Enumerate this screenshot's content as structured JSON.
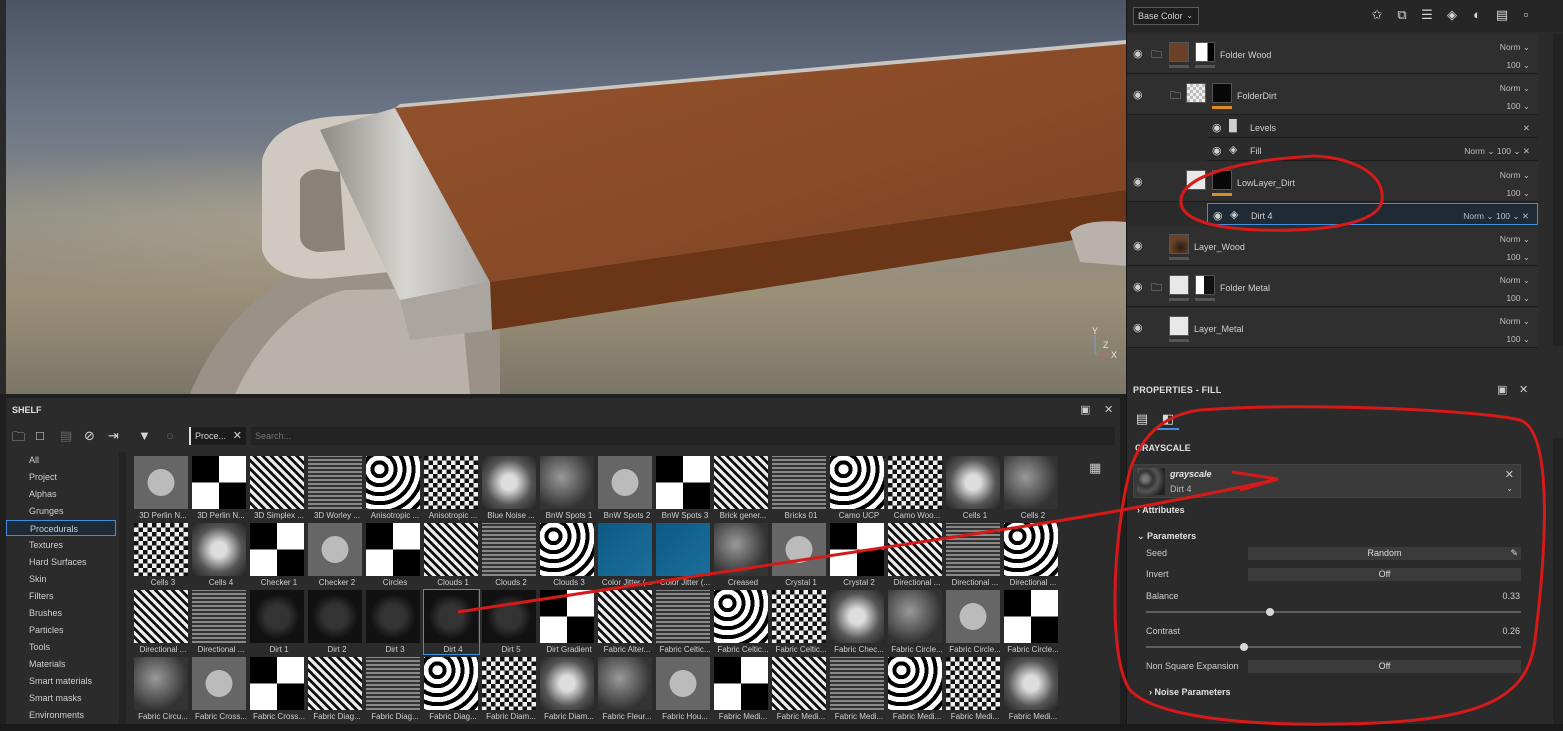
{
  "layer_stack": {
    "channel": "Base Color",
    "toolbar_icons": [
      "magic-wand-icon",
      "effect-icon",
      "add-layer-icon",
      "fill-layer-icon",
      "mask-icon",
      "folder-add-icon",
      "trash-icon"
    ],
    "layers": [
      {
        "name": "Folder Wood",
        "blend": "Norm",
        "opacity": "100"
      },
      {
        "name": "FolderDirt",
        "blend": "Norm",
        "opacity": "100"
      },
      {
        "name": "LowLayer_Dirt",
        "blend": "Norm",
        "opacity": "100"
      },
      {
        "name": "Layer_Wood",
        "blend": "Norm",
        "opacity": "100"
      },
      {
        "name": "Folder Metal",
        "blend": "Norm",
        "opacity": "100"
      },
      {
        "name": "Layer_Metal",
        "blend": "Norm",
        "opacity": "100"
      }
    ],
    "effects": [
      {
        "name": "Levels"
      },
      {
        "name": "Fill",
        "blend": "Norm",
        "opacity": "100"
      },
      {
        "name": "Dirt 4",
        "blend": "Norm",
        "opacity": "100"
      }
    ]
  },
  "properties": {
    "title": "PROPERTIES - FILL",
    "section": "GRAYSCALE",
    "resource": {
      "name": "grayscale",
      "sub": "Dirt 4"
    },
    "attributes_label": "Attributes",
    "parameters_label": "Parameters",
    "seed": {
      "label": "Seed",
      "value": "Random"
    },
    "invert": {
      "label": "Invert",
      "value": "Off"
    },
    "balance": {
      "label": "Balance",
      "value": "0.33",
      "level": 0.33
    },
    "contrast": {
      "label": "Contrast",
      "value": "0.26",
      "level": 0.26
    },
    "nse": {
      "label": "Non Square Expansion",
      "value": "Off"
    },
    "noise_label": "Noise Parameters"
  },
  "shelf": {
    "title": "SHELF",
    "filter_chip": "Proce...",
    "search_placeholder": "Search...",
    "categories": [
      "All",
      "Project",
      "Alphas",
      "Grunges",
      "Procedurals",
      "Textures",
      "Hard Surfaces",
      "Skin",
      "Filters",
      "Brushes",
      "Particles",
      "Tools",
      "Materials",
      "Smart materials",
      "Smart masks",
      "Environments"
    ],
    "active_category": "Procedurals",
    "tiles": [
      [
        "3D Perlin N...",
        "3D Perlin N...",
        "3D Simplex ...",
        "3D Worley ...",
        "Anisotropic ...",
        "Anisotropic ...",
        "Blue Noise ...",
        "BnW Spots 1",
        "BnW Spots 2",
        "BnW Spots 3",
        "Brick gener...",
        "Bricks 01",
        "Camo UCP",
        "Camo Woo...",
        "Cells 1",
        "Cells 2"
      ],
      [
        "Cells 3",
        "Cells 4",
        "Checker 1",
        "Checker 2",
        "Circles",
        "Clouds 1",
        "Clouds 2",
        "Clouds 3",
        "Color Jitter (...",
        "Color Jitter (...",
        "Creased",
        "Crystal 1",
        "Crystal 2",
        "Directional ...",
        "Directional ...",
        "Directional ..."
      ],
      [
        "Directional ...",
        "Directional ...",
        "Dirt 1",
        "Dirt 2",
        "Dirt 3",
        "Dirt 4",
        "Dirt 5",
        "Dirt Gradient",
        "Fabric Alter...",
        "Fabric Celtic...",
        "Fabric Celtic...",
        "Fabric Celtic...",
        "Fabric Chec...",
        "Fabric Circle...",
        "Fabric Circle...",
        "Fabric Circle..."
      ],
      [
        "Fabric Circu...",
        "Fabric Cross...",
        "Fabric Cross...",
        "Fabric Diag...",
        "Fabric Diag...",
        "Fabric Diag...",
        "Fabric Diam...",
        "Fabric Diam...",
        "Fabric Fleur...",
        "Fabric Hou...",
        "Fabric Medi...",
        "Fabric Medi...",
        "Fabric Medi...",
        "Fabric Medi...",
        "Fabric Medi...",
        "Fabric Medi..."
      ]
    ],
    "selected_tile": "Dirt 4"
  },
  "viewport": {
    "axis_y": "Y",
    "axis_x": "X",
    "axis_z": "Z"
  },
  "colors": {
    "accent": "#3f8fe0",
    "annotation": "#d61a1a",
    "wood": "#8b4a2a",
    "orange": "#e08c24"
  }
}
